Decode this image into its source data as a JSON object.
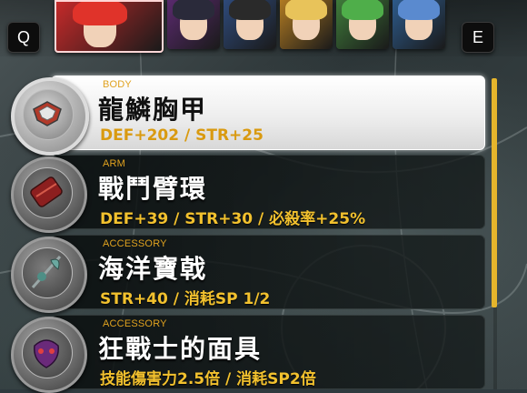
{
  "controls": {
    "prev_key": "Q",
    "next_key": "E"
  },
  "party": [
    {
      "icon": "red-haired-hero-portrait",
      "color": "#c42a2a",
      "hair": "#e0332a",
      "active": true
    },
    {
      "icon": "hatted-mage-portrait",
      "color": "#5a2a6e",
      "hair": "#2a2a3a"
    },
    {
      "icon": "dark-skinned-warrior-portrait",
      "color": "#2e4a7a",
      "hair": "#2a2a2a"
    },
    {
      "icon": "blonde-girl-portrait",
      "color": "#b07a22",
      "hair": "#e8c35a"
    },
    {
      "icon": "green-haired-portrait",
      "color": "#3f7a3a",
      "hair": "#4fae4a"
    },
    {
      "icon": "blue-haired-portrait",
      "color": "#2d5a8a",
      "hair": "#5a8acf"
    }
  ],
  "equipment": [
    {
      "slot": "BODY",
      "name": "龍鱗胸甲",
      "stats": "DEF+202 / STR+25",
      "icon": "dragon-scale-armor-icon",
      "selected": true
    },
    {
      "slot": "ARM",
      "name": "戰鬥臂環",
      "stats": "DEF+39 / STR+30 / 必殺率+25%",
      "icon": "battle-bracer-icon",
      "selected": false
    },
    {
      "slot": "ACCESSORY",
      "name": "海洋寶戟",
      "stats": "STR+40 / 消耗SP 1/2",
      "icon": "sea-halberd-icon",
      "selected": false
    },
    {
      "slot": "ACCESSORY",
      "name": "狂戰士的面具",
      "stats": "技能傷害力2.5倍 / 消耗SP2倍",
      "icon": "berserker-mask-icon",
      "selected": false
    }
  ],
  "colors": {
    "accent": "#e6b52c",
    "slot_label": "#e0a21f"
  }
}
